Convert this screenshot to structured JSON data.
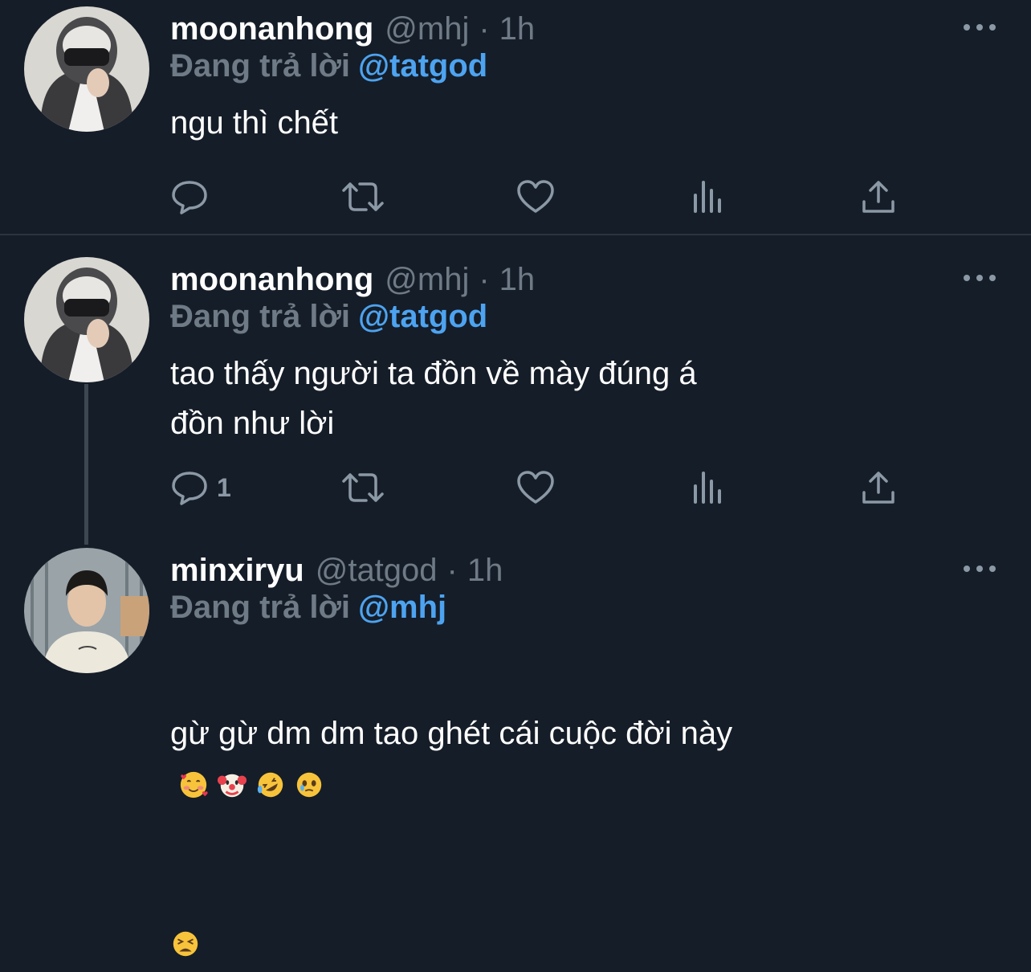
{
  "tweets": [
    {
      "author": "moonanhong",
      "handle": "@mhj",
      "dot": "·",
      "time": "1h",
      "replying_label": "Đang trả lời",
      "replying_to": "@tatgod",
      "text": "ngu thì chết",
      "reply_count": "",
      "avatar": "masked-person-avatar"
    },
    {
      "author": "moonanhong",
      "handle": "@mhj",
      "dot": "·",
      "time": "1h",
      "replying_label": "Đang trả lời",
      "replying_to": "@tatgod",
      "text": "tao thấy người ta đồn về mày đúng á\nđồn như lời",
      "reply_count": "1",
      "avatar": "masked-person-avatar"
    },
    {
      "author": "minxiryu",
      "handle": "@tatgod",
      "dot": "·",
      "time": "1h",
      "replying_label": "Đang trả lời",
      "replying_to": "@mhj",
      "text": "gừ gừ dm dm tao ghét cái cuộc đời này",
      "emojis": [
        "smiling-face-with-hearts",
        "clown-face",
        "rolling-on-floor-laughing",
        "face-holding-back-tears",
        "tired-face"
      ],
      "reply_count": "",
      "avatar": "young-man-avatar"
    }
  ],
  "icons": {
    "reply": "reply-icon",
    "retweet": "retweet-icon",
    "like": "like-icon",
    "analytics": "analytics-icon",
    "share": "share-icon",
    "more": "more-icon"
  },
  "colors": {
    "background": "#151d28",
    "muted": "#6e7a86",
    "mention": "#4da3f0",
    "divider": "#2c3440"
  }
}
